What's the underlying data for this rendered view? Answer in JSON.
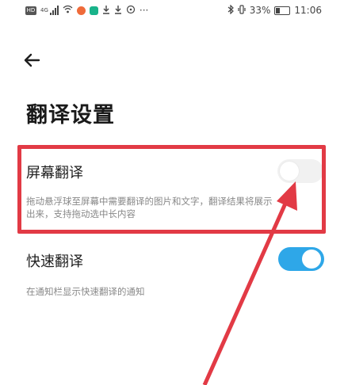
{
  "status_bar": {
    "left_badge": "HD",
    "network": "4G",
    "battery_percent": "33%",
    "time": "11:06"
  },
  "page": {
    "title": "翻译设置"
  },
  "settings": [
    {
      "title": "屏幕翻译",
      "description": "拖动悬浮球至屏幕中需要翻译的图片和文字，翻译结果将展示出来，支持拖动选中长内容",
      "enabled": false
    },
    {
      "title": "快速翻译",
      "description": "在通知栏显示快速翻译的通知",
      "enabled": true
    }
  ],
  "colors": {
    "toggle_on": "#2ea7e8",
    "toggle_off": "#f1f1f1",
    "annotation_red": "#e23a45"
  },
  "icons": [
    "back-arrow-icon",
    "signal-icon",
    "wifi-icon",
    "bluetooth-icon",
    "battery-icon",
    "download-icon"
  ]
}
